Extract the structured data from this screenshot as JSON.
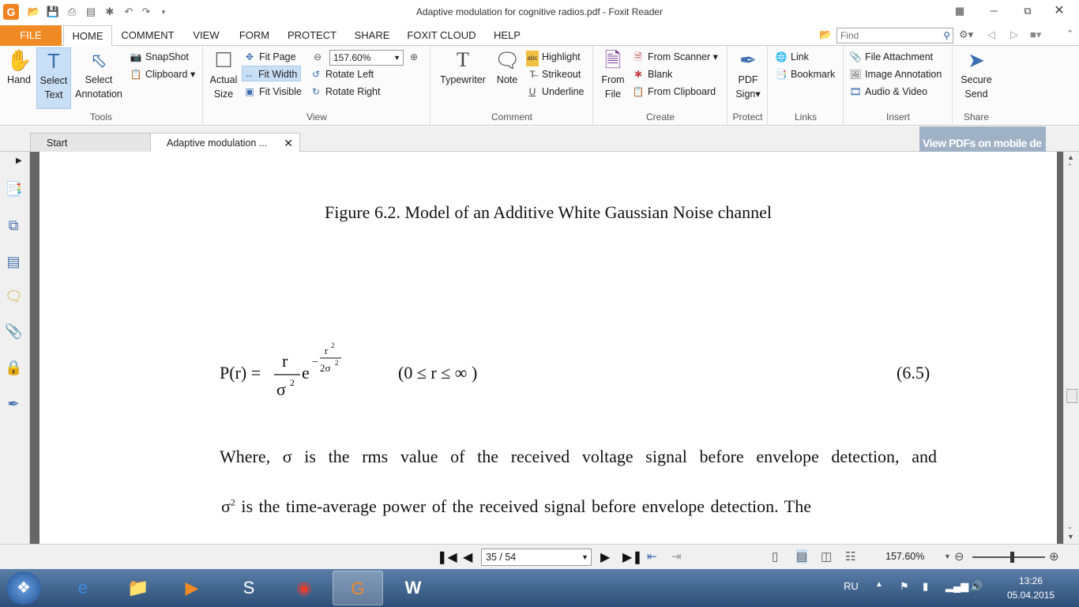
{
  "window": {
    "title": "Adaptive modulation for cognitive radios.pdf - Foxit Reader",
    "app_icon": "G"
  },
  "menu_tabs": [
    "FILE",
    "HOME",
    "COMMENT",
    "VIEW",
    "FORM",
    "PROTECT",
    "SHARE",
    "FOXIT CLOUD",
    "HELP"
  ],
  "active_tab": "HOME",
  "find": {
    "placeholder": "Find"
  },
  "ribbon": {
    "tools": {
      "label": "Tools",
      "hand": "Hand",
      "select_text_1": "Select",
      "select_text_2": "Text",
      "select_annotation_1": "Select",
      "select_annotation_2": "Annotation",
      "snapshot": "SnapShot",
      "clipboard": "Clipboard"
    },
    "view": {
      "label": "View",
      "actual_size_1": "Actual",
      "actual_size_2": "Size",
      "fit_page": "Fit Page",
      "fit_width": "Fit Width",
      "fit_visible": "Fit Visible",
      "zoom_value": "157.60%",
      "rotate_left": "Rotate Left",
      "rotate_right": "Rotate Right"
    },
    "comment": {
      "label": "Comment",
      "typewriter": "Typewriter",
      "note": "Note",
      "highlight": "Highlight",
      "strikeout": "Strikeout",
      "underline": "Underline"
    },
    "create": {
      "label": "Create",
      "from_file_1": "From",
      "from_file_2": "File",
      "from_scanner": "From Scanner",
      "blank": "Blank",
      "from_clipboard": "From Clipboard"
    },
    "protect": {
      "label": "Protect",
      "pdf_sign_1": "PDF",
      "pdf_sign_2": "Sign"
    },
    "links": {
      "label": "Links",
      "link": "Link",
      "bookmark": "Bookmark"
    },
    "insert": {
      "label": "Insert",
      "file_attachment": "File Attachment",
      "image_annotation": "Image Annotation",
      "audio_video": "Audio & Video"
    },
    "share": {
      "label": "Share",
      "secure_send_1": "Secure",
      "secure_send_2": "Send"
    }
  },
  "doc_tabs": [
    {
      "label": "Start"
    },
    {
      "label": "Adaptive modulation ..."
    }
  ],
  "ad_banner": "View PDFs on mobile de",
  "document": {
    "figure_caption": "Figure 6.2.  Model of an Additive White Gaussian Noise channel",
    "equation": {
      "lhs": "P(r) =",
      "num": "r",
      "den": "σ",
      "den_exp": "2",
      "e": "e",
      "exp_sign": "−",
      "exp_num": "r",
      "exp_num_exp": "2",
      "exp_den": "2σ",
      "exp_den_exp": "2",
      "condition": "(0 ≤ r ≤ ∞ )",
      "number": "(6.5)"
    },
    "line1": "Where,  σ  is the rms value of the received voltage signal before envelope detection, and",
    "line2_sigma": "σ",
    "line2_exp": "2",
    "line2_rest": "  is  the  time-average  power  of  the  received  signal  before  envelope  detection.  The"
  },
  "status": {
    "page_value": "35 / 54",
    "zoom": "157.60%"
  },
  "taskbar": {
    "language": "RU",
    "time": "13:26",
    "date": "05.04.2015"
  }
}
